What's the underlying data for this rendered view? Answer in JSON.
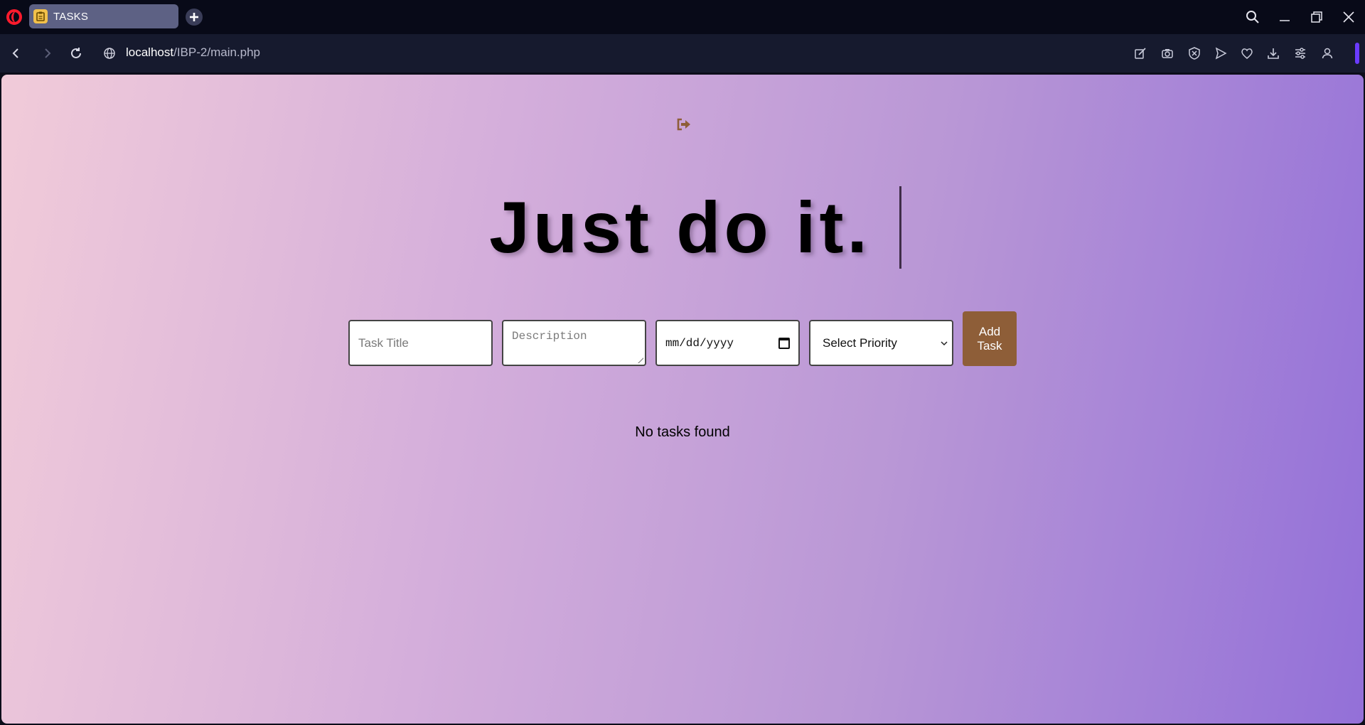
{
  "browser": {
    "tab": {
      "title": "TASKS",
      "favicon": "clipboard-icon"
    },
    "new_tab_icon": "plus-icon",
    "url": {
      "host": "localhost",
      "path": "/IBP-2/main.php"
    },
    "accent_color": "#6a3bff"
  },
  "page": {
    "headline": "Just do it.",
    "form": {
      "title_placeholder": "Task Title",
      "description_placeholder": "Description",
      "date_placeholder": "mm/dd/yyyy",
      "priority_selected": "Select Priority",
      "add_button": "Add\nTask"
    },
    "empty_message": "No tasks found",
    "colors": {
      "gradient_start": "#f1cbd9",
      "gradient_end": "#9370d8",
      "button": "#8e5e38"
    }
  }
}
